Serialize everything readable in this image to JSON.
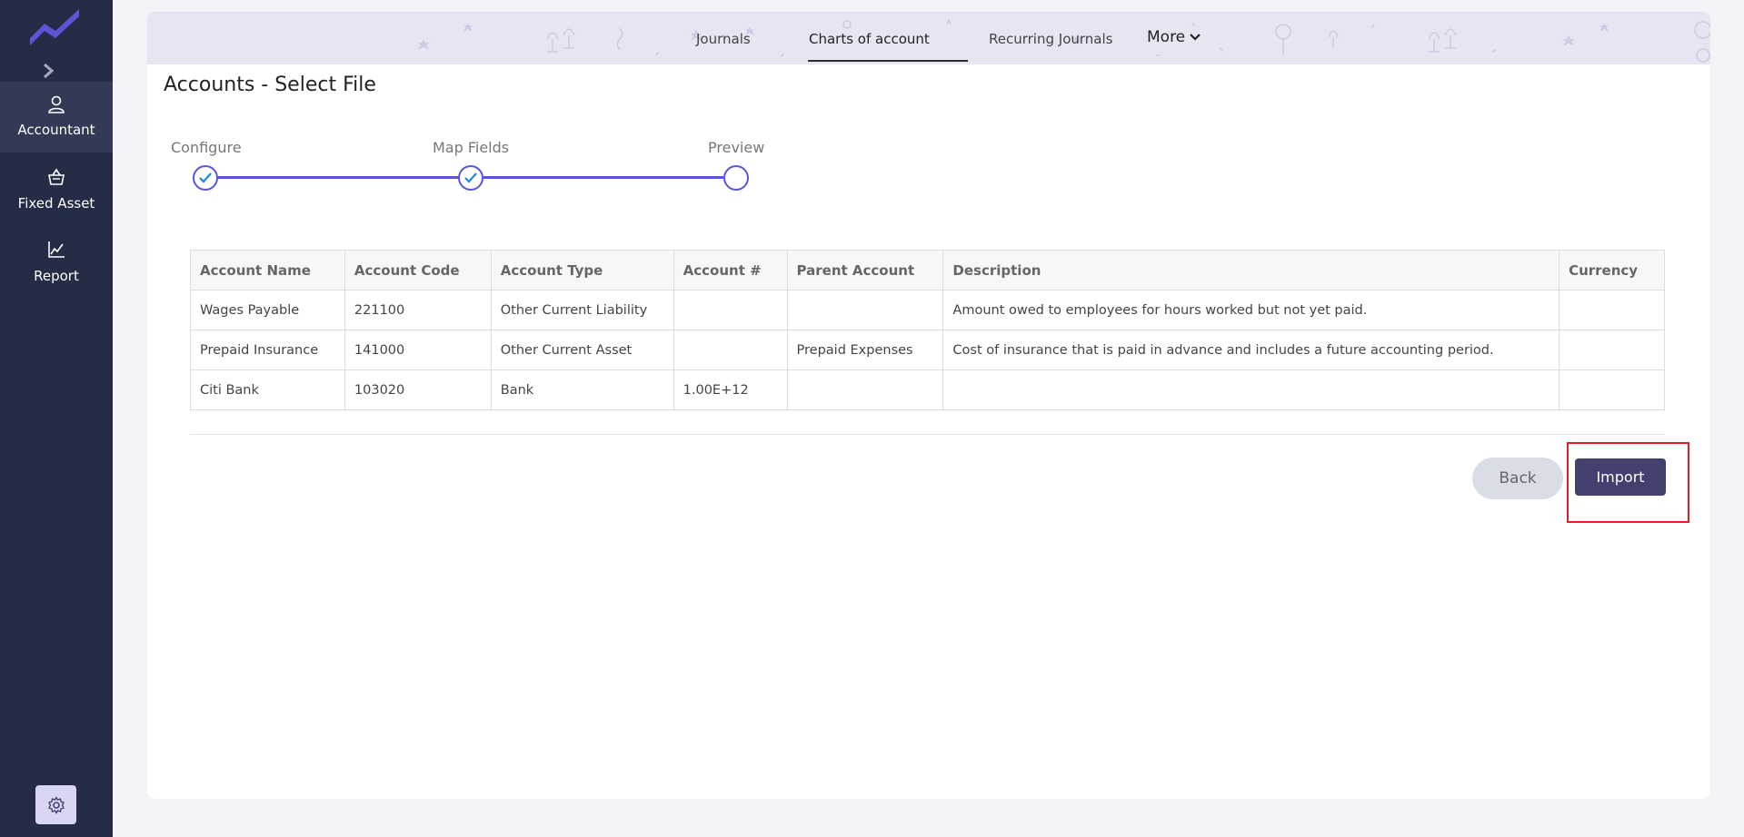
{
  "sidebar": {
    "items": [
      {
        "label": "Accountant",
        "icon": "user-icon"
      },
      {
        "label": "Fixed Asset",
        "icon": "basket-icon"
      },
      {
        "label": "Report",
        "icon": "chart-icon"
      }
    ],
    "settings_icon": "gear-icon"
  },
  "tabs": {
    "journals": "Journals",
    "charts_of_account": "Charts of account",
    "recurring_journals": "Recurring Journals",
    "more": "More"
  },
  "page": {
    "title": "Accounts - Select File"
  },
  "stepper": {
    "steps": [
      {
        "label": "Configure",
        "status": "completed"
      },
      {
        "label": "Map Fields",
        "status": "completed"
      },
      {
        "label": "Preview",
        "status": "current"
      }
    ]
  },
  "table": {
    "headers": [
      "Account Name",
      "Account Code",
      "Account Type",
      "Account #",
      "Parent Account",
      "Description",
      "Currency"
    ],
    "rows": [
      [
        "Wages Payable",
        "221100",
        "Other Current Liability",
        "",
        "",
        "Amount owed to employees for hours worked but not yet paid.",
        ""
      ],
      [
        "Prepaid Insurance",
        "141000",
        "Other Current Asset",
        "",
        "Prepaid Expenses",
        "Cost of insurance that is paid in advance and includes a future accounting period.",
        ""
      ],
      [
        "Citi Bank",
        "103020",
        "Bank",
        "1.00E+12",
        "",
        "",
        ""
      ]
    ]
  },
  "buttons": {
    "back": "Back",
    "import": "Import"
  },
  "colors": {
    "sidebar": "#252c46",
    "accent": "#5b56d6",
    "primary_button": "#42406f",
    "highlight": "#e02020"
  }
}
